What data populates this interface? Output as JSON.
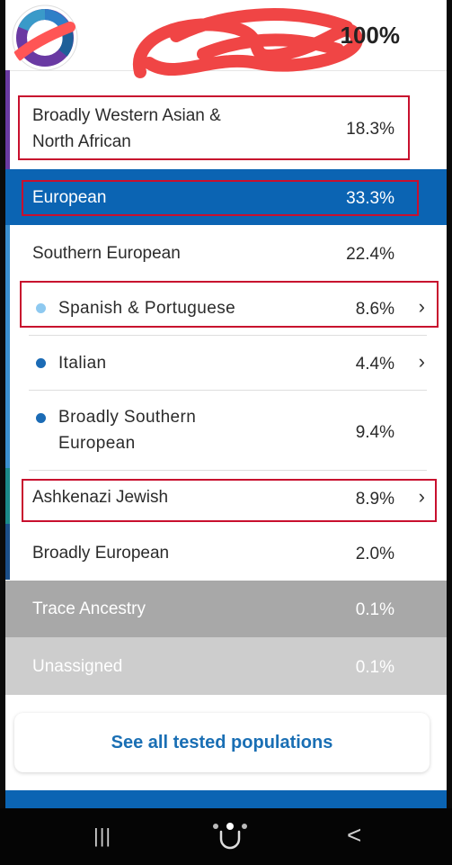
{
  "header": {
    "percent": "100%"
  },
  "rows": [
    {
      "label": "Broadly Western Asian & North African",
      "value": "18.3%"
    },
    {
      "label": "European",
      "value": "33.3%"
    },
    {
      "label": "Southern European",
      "value": "22.4%"
    },
    {
      "label": "Spanish & Portuguese",
      "value": "8.6%"
    },
    {
      "label": "Italian",
      "value": "4.4%"
    },
    {
      "label": "Broadly Southern European",
      "value": "9.4%"
    },
    {
      "label": "Ashkenazi Jewish",
      "value": "8.9%"
    },
    {
      "label": "Broadly European",
      "value": "2.0%"
    },
    {
      "label": "Trace Ancestry",
      "value": "0.1%"
    },
    {
      "label": "Unassigned",
      "value": "0.1%"
    }
  ],
  "see_all": "See all tested populations",
  "colors": {
    "european_header": "#0b64b3",
    "trace": "#a8a8a8",
    "unassigned": "#cdcdcd",
    "dot_light": "#8ec9f0",
    "dot_dark": "#1b6bb5",
    "highlight_box": "#c8102e"
  },
  "nav": {
    "recents": "|||",
    "home": "home-icon",
    "back": "<"
  }
}
